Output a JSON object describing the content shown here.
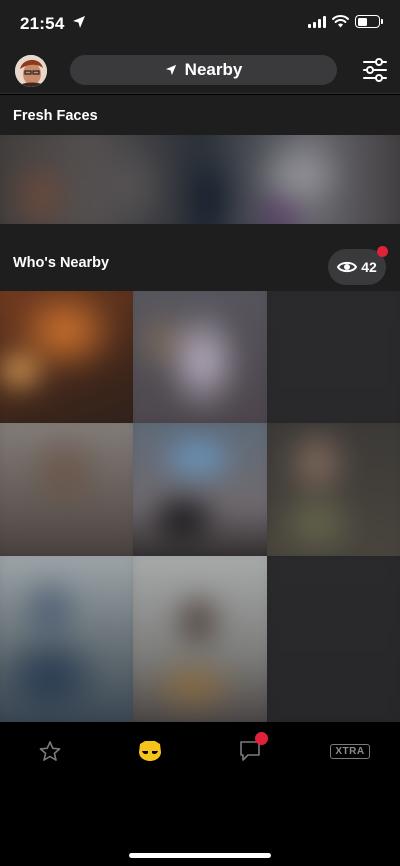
{
  "status": {
    "time": "21:54"
  },
  "header": {
    "location_label": "Nearby"
  },
  "sections": {
    "fresh_faces": "Fresh Faces",
    "whos_nearby": "Who's Nearby"
  },
  "viewers": {
    "count": "42"
  },
  "tabs": {
    "xtra_label": "XTRA"
  },
  "colors": {
    "accent": "#f6c21c",
    "notification": "#e0213a",
    "pill": "#3a3a3d"
  },
  "icons": {
    "location": "location-arrow-icon",
    "filter": "filter-sliders-icon",
    "viewers": "eye-icon",
    "favorites": "star-icon",
    "browse": "mask-icon",
    "chat": "chat-bubble-icon"
  }
}
